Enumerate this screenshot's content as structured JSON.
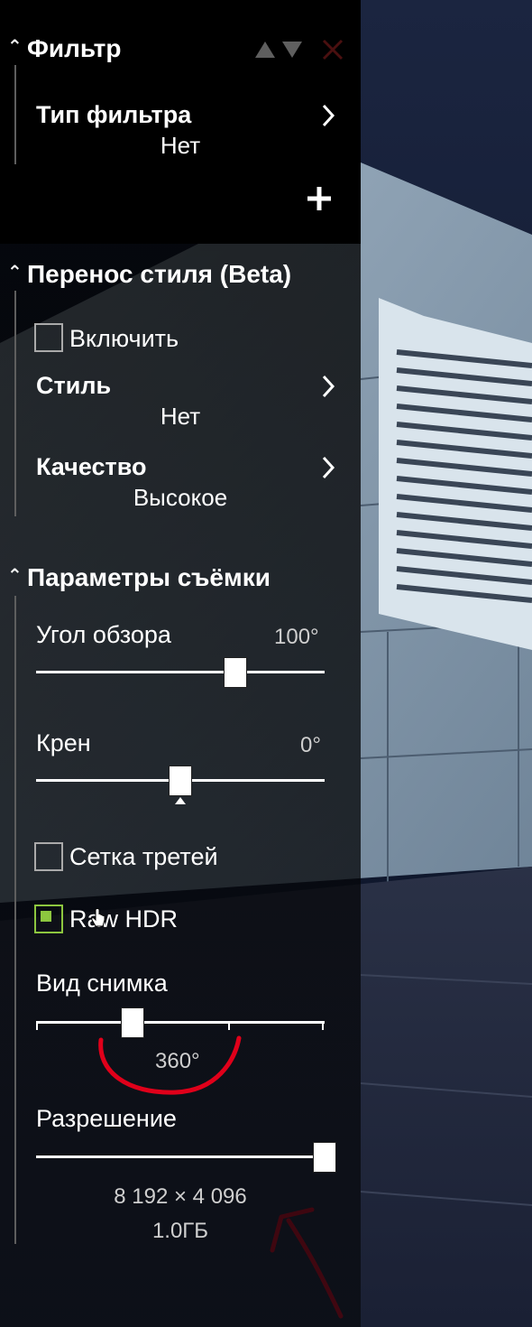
{
  "filter_section": {
    "title": "Фильтр",
    "filter_type_label": "Тип фильтра",
    "filter_type_value": "Нет",
    "icons": [
      "move-up-icon",
      "move-down-icon",
      "remove-icon",
      "add-icon"
    ]
  },
  "style_section": {
    "title": "Перенос стиля (Beta)",
    "enable_label": "Включить",
    "enable_checked": false,
    "style_label": "Стиль",
    "style_value": "Нет",
    "quality_label": "Качество",
    "quality_value": "Высокое"
  },
  "capture_section": {
    "title": "Параметры съёмки",
    "fov_label": "Угол обзора",
    "fov_value": "100°",
    "fov_fraction": 0.69,
    "roll_label": "Крен",
    "roll_value": "0°",
    "roll_fraction": 0.5,
    "grid_label": "Сетка третей",
    "grid_checked": false,
    "raw_label": "Raw HDR",
    "raw_checked": true,
    "shot_label": "Вид снимка",
    "shot_value": "360°",
    "shot_step": 1,
    "shot_steps": 3,
    "resolution_label": "Разрешение",
    "resolution_value": "8 192 × 4 096",
    "resolution_size": "1.0ГБ",
    "resolution_fraction": 1.0
  },
  "colors": {
    "accent_checked": "#8dc63f",
    "annotation": "#e0001a"
  }
}
